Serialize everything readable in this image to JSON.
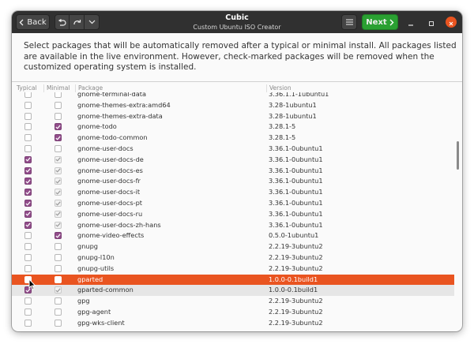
{
  "titlebar": {
    "back_label": "Back",
    "app_name": "Cubic",
    "subtitle": "Custom Ubuntu ISO Creator",
    "next_label": "Next"
  },
  "description": "Select packages that will be automatically removed after a typical or minimal install. All packages listed are available in the live environment. However, check-marked packages will be removed when the customized operating system is installed.",
  "table": {
    "columns": [
      "Typical",
      "Minimal",
      "Package",
      "Version"
    ],
    "rows": [
      {
        "package": "gnome-terminal-data",
        "version": "3.36.1.1-1ubuntu1",
        "typical": false,
        "minimal": false
      },
      {
        "package": "gnome-themes-extra:amd64",
        "version": "3.28-1ubuntu1",
        "typical": false,
        "minimal": false
      },
      {
        "package": "gnome-themes-extra-data",
        "version": "3.28-1ubuntu1",
        "typical": false,
        "minimal": false
      },
      {
        "package": "gnome-todo",
        "version": "3.28.1-5",
        "typical": false,
        "minimal": true
      },
      {
        "package": "gnome-todo-common",
        "version": "3.28.1-5",
        "typical": false,
        "minimal": true
      },
      {
        "package": "gnome-user-docs",
        "version": "3.36.1-0ubuntu1",
        "typical": false,
        "minimal": false
      },
      {
        "package": "gnome-user-docs-de",
        "version": "3.36.1-0ubuntu1",
        "typical": true,
        "minimal": "implied"
      },
      {
        "package": "gnome-user-docs-es",
        "version": "3.36.1-0ubuntu1",
        "typical": true,
        "minimal": "implied"
      },
      {
        "package": "gnome-user-docs-fr",
        "version": "3.36.1-0ubuntu1",
        "typical": true,
        "minimal": "implied"
      },
      {
        "package": "gnome-user-docs-it",
        "version": "3.36.1-0ubuntu1",
        "typical": true,
        "minimal": "implied"
      },
      {
        "package": "gnome-user-docs-pt",
        "version": "3.36.1-0ubuntu1",
        "typical": true,
        "minimal": "implied"
      },
      {
        "package": "gnome-user-docs-ru",
        "version": "3.36.1-0ubuntu1",
        "typical": true,
        "minimal": "implied"
      },
      {
        "package": "gnome-user-docs-zh-hans",
        "version": "3.36.1-0ubuntu1",
        "typical": true,
        "minimal": "implied"
      },
      {
        "package": "gnome-video-effects",
        "version": "0.5.0-1ubuntu1",
        "typical": false,
        "minimal": true
      },
      {
        "package": "gnupg",
        "version": "2.2.19-3ubuntu2",
        "typical": false,
        "minimal": false
      },
      {
        "package": "gnupg-l10n",
        "version": "2.2.19-3ubuntu2",
        "typical": false,
        "minimal": false
      },
      {
        "package": "gnupg-utils",
        "version": "2.2.19-3ubuntu2",
        "typical": false,
        "minimal": false
      },
      {
        "package": "gparted",
        "version": "1.0.0-0.1build1",
        "typical": false,
        "minimal": false,
        "state": "selected"
      },
      {
        "package": "gparted-common",
        "version": "1.0.0-0.1build1",
        "typical": true,
        "minimal": "implied",
        "state": "hover"
      },
      {
        "package": "gpg",
        "version": "2.2.19-3ubuntu2",
        "typical": false,
        "minimal": false
      },
      {
        "package": "gpg-agent",
        "version": "2.2.19-3ubuntu2",
        "typical": false,
        "minimal": false
      },
      {
        "package": "gpg-wks-client",
        "version": "2.2.19-3ubuntu2",
        "typical": false,
        "minimal": false
      }
    ]
  },
  "colors": {
    "accent_orange": "#e95420",
    "check_purple": "#924d8b",
    "next_green": "#2aa032",
    "titlebar": "#303030"
  },
  "icons": {
    "back": "chevron-left-icon",
    "undo": "undo-icon",
    "redo": "redo-icon",
    "dropdown": "chevron-down-icon",
    "menu": "hamburger-menu-icon",
    "next": "chevron-right-icon",
    "minimize": "minimize-icon",
    "maximize": "maximize-icon",
    "close": "close-icon",
    "cursor": "mouse-pointer-icon"
  }
}
